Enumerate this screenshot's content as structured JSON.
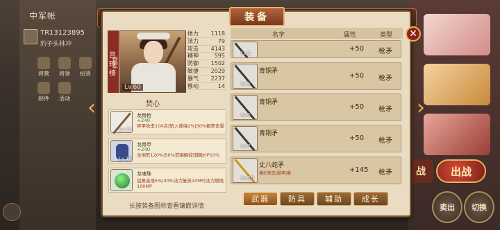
{
  "background": {
    "title": "中军帐",
    "player_id": "TR13123895",
    "player_subtitle": "豹子头林冲",
    "icons": [
      {
        "label": "将营",
        "icon": "general-camp-icon"
      },
      {
        "label": "将领",
        "icon": "generals-icon"
      },
      {
        "label": "招贤",
        "icon": "recruit-icon"
      },
      {
        "label": "邮件",
        "icon": "mail-icon"
      },
      {
        "label": "活动",
        "icon": "event-icon"
      }
    ],
    "buttons": {
      "battle_left": "战",
      "battle": "出战",
      "depart": "卖出",
      "switch": "切换"
    }
  },
  "panel": {
    "title": "装备",
    "close_label": "✕",
    "left_arrow": "‹",
    "right_arrow": "›",
    "hero": {
      "tag": "营军",
      "name": "吕玲绮",
      "level": "Lv.60",
      "stats": [
        {
          "label": "体力",
          "value": "1118"
        },
        {
          "label": "法力",
          "value": "79"
        },
        {
          "label": "攻击",
          "value": "4143"
        },
        {
          "label": "精神",
          "value": "595"
        },
        {
          "label": "防御",
          "value": "1502"
        },
        {
          "label": "敏捷",
          "value": "2029"
        },
        {
          "label": "暴气",
          "value": "2237"
        },
        {
          "label": "移动",
          "value": "14"
        }
      ]
    },
    "section_label": "焚心",
    "equipped": [
      {
        "name": "龙骨枪",
        "plus": "+240",
        "level": "Lv.15",
        "desc": "碎甲攻击100点|斩入佳境2%|50%概率击晕",
        "icon": "spear-icon"
      },
      {
        "name": "龙骨甲",
        "plus": "+240",
        "level": "Lv.15",
        "desc": "全地形120%|50%范围解控|辅助HP10%",
        "icon": "armor-icon"
      },
      {
        "name": "龙魂珠",
        "plus": "",
        "level": "",
        "desc": "战意高涨5%|30%法力复苏10MP|法力燃烧100MP",
        "icon": "jade-orb-icon"
      }
    ],
    "hint": "长按装备图标查看镶嵌详情",
    "list": {
      "headers": {
        "name": "名字",
        "attr": "属性",
        "type": "类型"
      },
      "rows": [
        {
          "name": "",
          "level": "Lv.1",
          "attr": "+50",
          "type": "枪矛",
          "note": "",
          "icon": "spear-icon"
        },
        {
          "name": "青铜矛",
          "level": "Lv.1",
          "attr": "+50",
          "type": "枪矛",
          "note": "",
          "icon": "spear-icon"
        },
        {
          "name": "青铜矛",
          "level": "Lv.1",
          "attr": "+50",
          "type": "枪矛",
          "note": "",
          "icon": "spear-icon"
        },
        {
          "name": "青铜矛",
          "level": "Lv.1",
          "attr": "+50",
          "type": "枪矛",
          "note": "",
          "icon": "spear-icon"
        },
        {
          "name": "丈八蛇矛",
          "level": "Lv.10",
          "attr": "+145",
          "type": "枪矛",
          "note": "横扫攻击|破甲|毒",
          "icon": "serpent-spear-icon"
        }
      ]
    },
    "tabs": [
      "武器",
      "防具",
      "辅助",
      "成长"
    ],
    "active_tab": 0
  },
  "colors": {
    "panel_bg": "#e9dcc3",
    "accent_gold": "#e9b84a",
    "title_red": "#7a3a1e",
    "positive_green": "#3c8a2c"
  }
}
